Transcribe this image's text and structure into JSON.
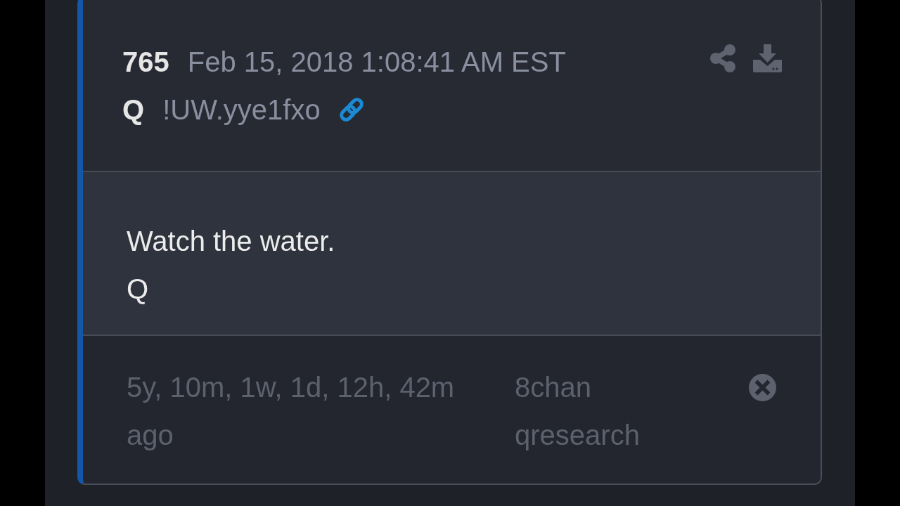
{
  "post": {
    "number": "765",
    "timestamp": "Feb 15, 2018 1:08:41 AM EST",
    "author": "Q",
    "tripcode": "!UW.yye1fxo"
  },
  "body": {
    "lines": [
      "Watch the water.",
      "Q"
    ]
  },
  "footer": {
    "elapsed": "5y, 10m, 1w, 1d, 12h, 42m ago",
    "source": [
      "8chan",
      "qresearch"
    ]
  }
}
